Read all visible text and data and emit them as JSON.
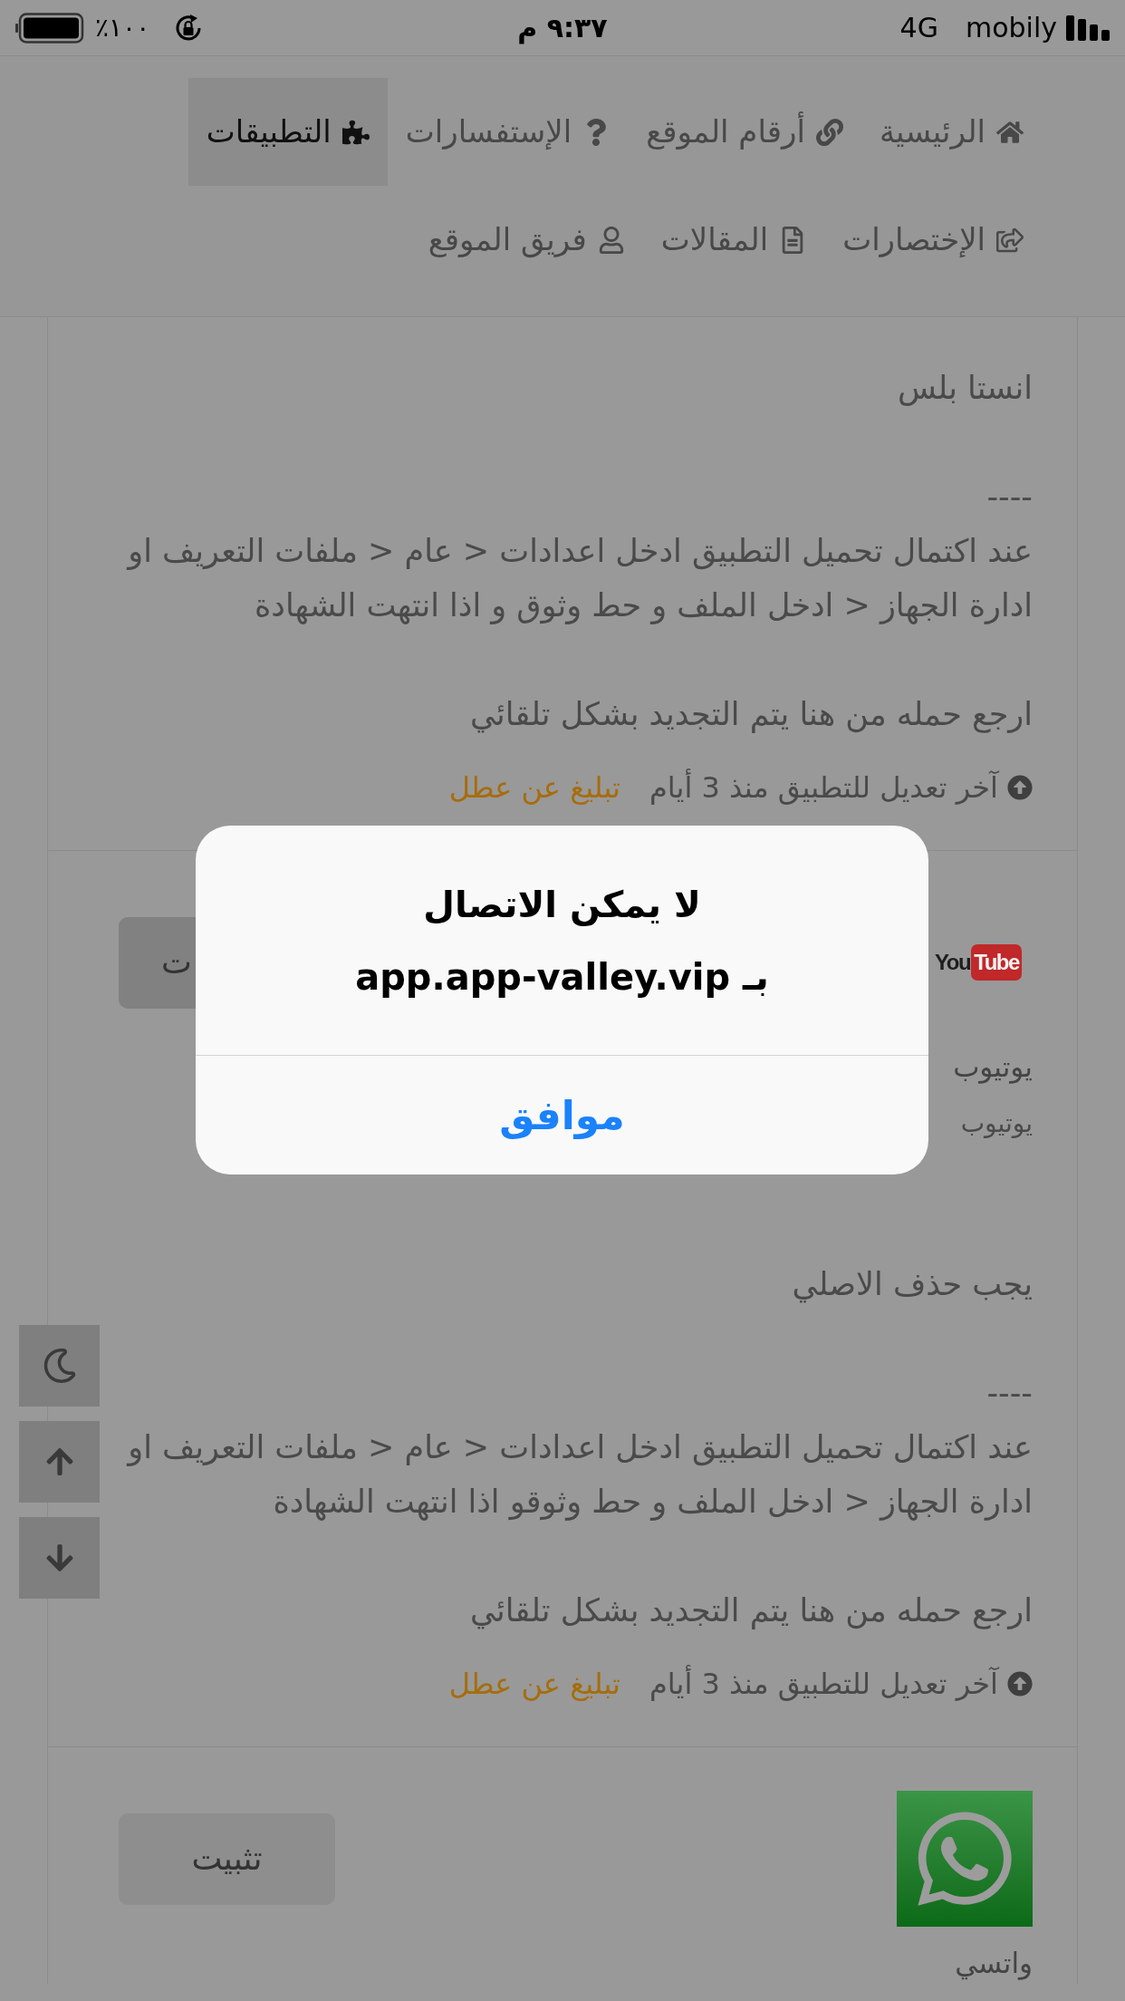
{
  "status_bar": {
    "battery": "١٠٠٪",
    "time": "٩:٣٧ م",
    "network": "4G",
    "carrier": "mobily"
  },
  "nav": {
    "rows": [
      {
        "items": [
          {
            "label": "الرئيسية",
            "selected": false
          },
          {
            "label": "أرقام الموقع",
            "selected": false
          },
          {
            "label": "الإستفسارات",
            "selected": false
          },
          {
            "label": "التطبيقات",
            "selected": true
          }
        ]
      },
      {
        "items": [
          {
            "label": "الإختصارات",
            "selected": false
          },
          {
            "label": "المقالات",
            "selected": false
          },
          {
            "label": "فريق الموقع",
            "selected": false
          }
        ]
      }
    ]
  },
  "apps": [
    {
      "description": "انستا بلس\n\n----\nعند اكتمال تحميل التطبيق ادخل اعدادات < عام < ملفات التعريف او ادارة الجهاز < ادخل الملف و حط وثوق و اذا انتهت الشهادة\n\nارجع حمله من هنا يتم التجديد بشكل تلقائي",
      "footer": {
        "updated": "آخر تعديل للتطبيق منذ 3 أيام",
        "report": "تبليغ عن عطل"
      }
    },
    {
      "logo": {
        "kind": "wordmark",
        "text": "You",
        "badge": "Tube"
      },
      "install_button": {
        "label": "ت",
        "covered": true,
        "pressed": true
      },
      "title": "يوتيوب",
      "subtitle": "يوتيوب",
      "description": "يجب حذف الاصلي\n\n----\nعند اكتمال تحميل التطبيق ادخل اعدادات < عام < ملفات التعريف او ادارة الجهاز < ادخل الملف و حط وثوقو اذا انتهت الشهادة\n\nارجع حمله من هنا يتم التجديد بشكل تلقائي",
      "footer": {
        "updated": "آخر تعديل للتطبيق منذ 3 أيام",
        "report": "تبليغ عن عطل"
      }
    },
    {
      "logo": {
        "kind": "icon"
      },
      "install_button": {
        "label": "تثبيت",
        "covered": false,
        "pressed": false
      },
      "title": "واتسي"
    }
  ],
  "alert": {
    "title": "لا يمكن الاتصال\nبـ app.app-valley.vip",
    "button": "موافق"
  }
}
